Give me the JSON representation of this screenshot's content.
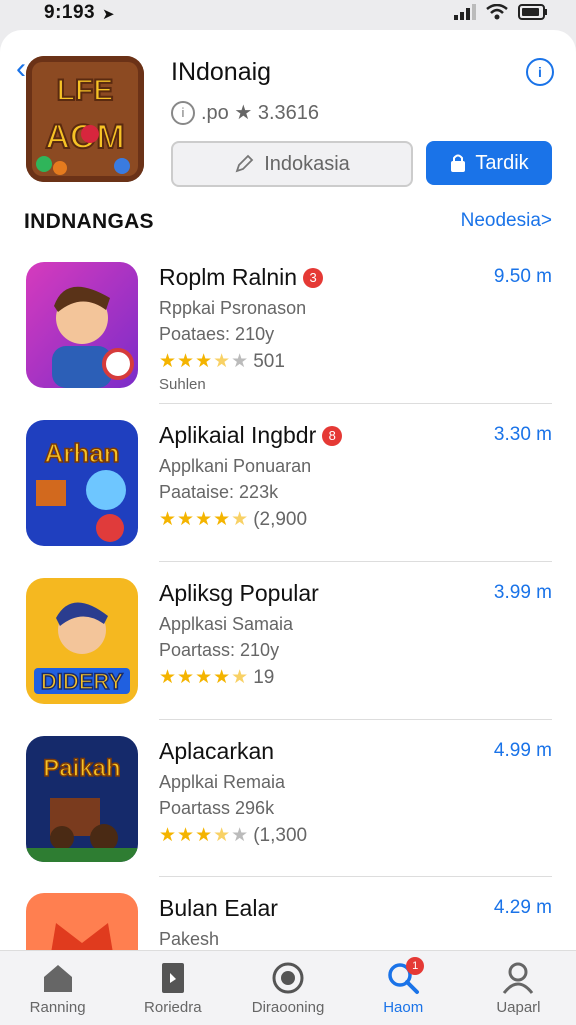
{
  "status_bar": {
    "time": "9:193"
  },
  "header": {
    "title": "INdonaig",
    "meta": ".po ★ 3.3616",
    "secondary_button": "Indokasia",
    "primary_button": "Tardik",
    "icon_text": "LFE AOM"
  },
  "section": {
    "title": "INDNANGAS",
    "link": "Neodesia>"
  },
  "apps": [
    {
      "name": "Roplm Ralnin",
      "badge": "3",
      "price": "9.50 m",
      "subtitle": "Rppkai Psronason",
      "release": "Poataes: 210y",
      "rating_count": "501",
      "extra": "Suhlen",
      "stars": 3.5
    },
    {
      "name": "Aplikaial Ingbdr",
      "badge": "8",
      "price": "3.30 m",
      "subtitle": "Applkani Ponuaran",
      "release": "Paataise: 223k",
      "rating_count": "(2,900",
      "extra": "",
      "stars": 4.5
    },
    {
      "name": "Apliksg Popular",
      "badge": "",
      "price": "3.99 m",
      "subtitle": "Applkasi Samaia",
      "release": "Poartass: 210y",
      "rating_count": "19",
      "extra": "",
      "stars": 4.5
    },
    {
      "name": "Aplacarkan",
      "badge": "",
      "price": "4.99 m",
      "subtitle": "Applkai Remaia",
      "release": "Poartass 296k",
      "rating_count": "(1,300",
      "extra": "",
      "stars": 3.5
    },
    {
      "name": "Bulan Ealar",
      "badge": "",
      "price": "4.29 m",
      "subtitle": "Pakesh",
      "release": "",
      "rating_count": "",
      "extra": "",
      "stars": 0
    }
  ],
  "tabs": [
    {
      "label": "Ranning",
      "icon": "home-icon"
    },
    {
      "label": "Roriedra",
      "icon": "book-icon"
    },
    {
      "label": "Diraooning",
      "icon": "globe-icon"
    },
    {
      "label": "Haom",
      "icon": "search-icon",
      "badge": "1"
    },
    {
      "label": "Uaparl",
      "icon": "person-icon"
    }
  ],
  "colors": {
    "accent": "#1a73e8",
    "badge": "#e53935",
    "star": "#f4b400"
  }
}
